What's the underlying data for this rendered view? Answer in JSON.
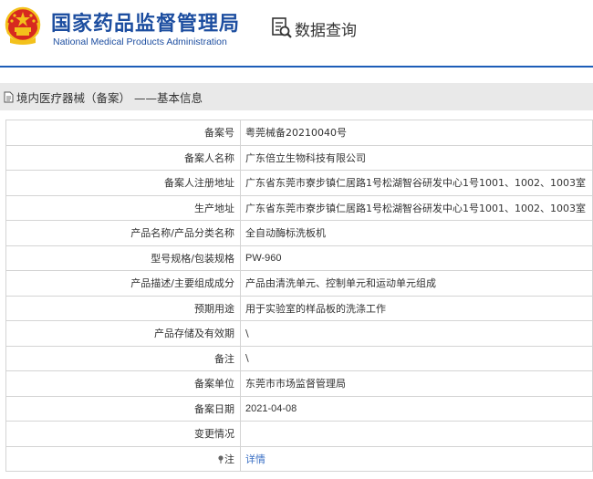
{
  "header": {
    "title_cn": "国家药品监督管理局",
    "title_en": "National Medical Products Administration",
    "query_label": "数据查询",
    "colors": {
      "brand": "#1d4ea0",
      "emblem_red": "#d7291f",
      "emblem_gold": "#f3c11b",
      "rule": "#1d5db8"
    }
  },
  "breadcrumb": "境内医疗器械（备案） ——基本信息",
  "rows": [
    {
      "label": "备案号",
      "value": "粤莞械备20210040号"
    },
    {
      "label": "备案人名称",
      "value": "广东倍立生物科技有限公司"
    },
    {
      "label": "备案人注册地址",
      "value": "广东省东莞市寮步镇仁居路1号松湖智谷研发中心1号1001、1002、1003室"
    },
    {
      "label": "生产地址",
      "value": "广东省东莞市寮步镇仁居路1号松湖智谷研发中心1号1001、1002、1003室"
    },
    {
      "label": "产品名称/产品分类名称",
      "value": "全自动酶标洗板机"
    },
    {
      "label": "型号规格/包装规格",
      "value": "PW-960"
    },
    {
      "label": "产品描述/主要组成成分",
      "value": "产品由清洗单元、控制单元和运动单元组成"
    },
    {
      "label": "预期用途",
      "value": "用于实验室的样品板的洗涤工作"
    },
    {
      "label": "产品存储及有效期",
      "value": "\\"
    },
    {
      "label": "备注",
      "value": "\\"
    },
    {
      "label": "备案单位",
      "value": "东莞市市场监督管理局"
    },
    {
      "label": "备案日期",
      "value": "2021-04-08"
    },
    {
      "label": "变更情况",
      "value": ""
    },
    {
      "label": "注",
      "value": "详情"
    }
  ]
}
